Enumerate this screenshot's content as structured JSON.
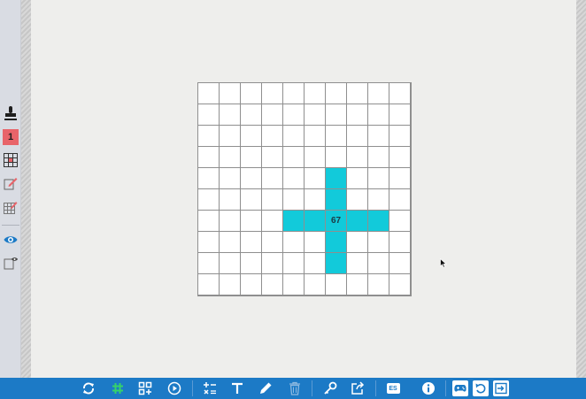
{
  "sidebar": {
    "items": [
      {
        "name": "stamp",
        "icon": "stamp-icon"
      },
      {
        "name": "level",
        "label": "1",
        "color": "#e8646a"
      },
      {
        "name": "grid-large",
        "icon": "grid-icon"
      },
      {
        "name": "edit-note",
        "icon": "edit-icon"
      },
      {
        "name": "edit-grid",
        "icon": "grid-edit-icon"
      },
      {
        "name": "visibility",
        "icon": "eye-icon",
        "color": "#1c7ac6"
      },
      {
        "name": "view-note",
        "icon": "note-eye-icon"
      }
    ]
  },
  "board": {
    "rows": 10,
    "cols": 10,
    "fill_color": "#12cada",
    "filled": [
      [
        4,
        6
      ],
      [
        5,
        6
      ],
      [
        6,
        4
      ],
      [
        6,
        5
      ],
      [
        6,
        6
      ],
      [
        6,
        7
      ],
      [
        6,
        8
      ],
      [
        7,
        6
      ],
      [
        8,
        6
      ]
    ],
    "label": {
      "row": 6,
      "col": 6,
      "text": "67"
    }
  },
  "toolbar": {
    "background": "#1c7ac6",
    "buttons": [
      {
        "name": "refresh",
        "icon": "refresh-icon"
      },
      {
        "name": "grid-toggle",
        "icon": "hash-icon",
        "color": "#35d26b"
      },
      {
        "name": "pieces",
        "icon": "grid-add-icon"
      },
      {
        "name": "play",
        "icon": "play-icon"
      },
      {
        "name": "operations",
        "icon": "math-ops-icon"
      },
      {
        "name": "text",
        "icon": "text-icon"
      },
      {
        "name": "pencil",
        "icon": "pencil-icon"
      },
      {
        "name": "trash",
        "icon": "trash-icon"
      },
      {
        "name": "key",
        "icon": "key-icon"
      },
      {
        "name": "share",
        "icon": "share-icon"
      },
      {
        "name": "language",
        "label": "ES"
      },
      {
        "name": "info",
        "icon": "info-icon"
      },
      {
        "name": "gamepad",
        "icon": "gamepad-icon"
      },
      {
        "name": "undo",
        "icon": "undo-icon"
      },
      {
        "name": "exit",
        "icon": "exit-icon"
      }
    ]
  }
}
